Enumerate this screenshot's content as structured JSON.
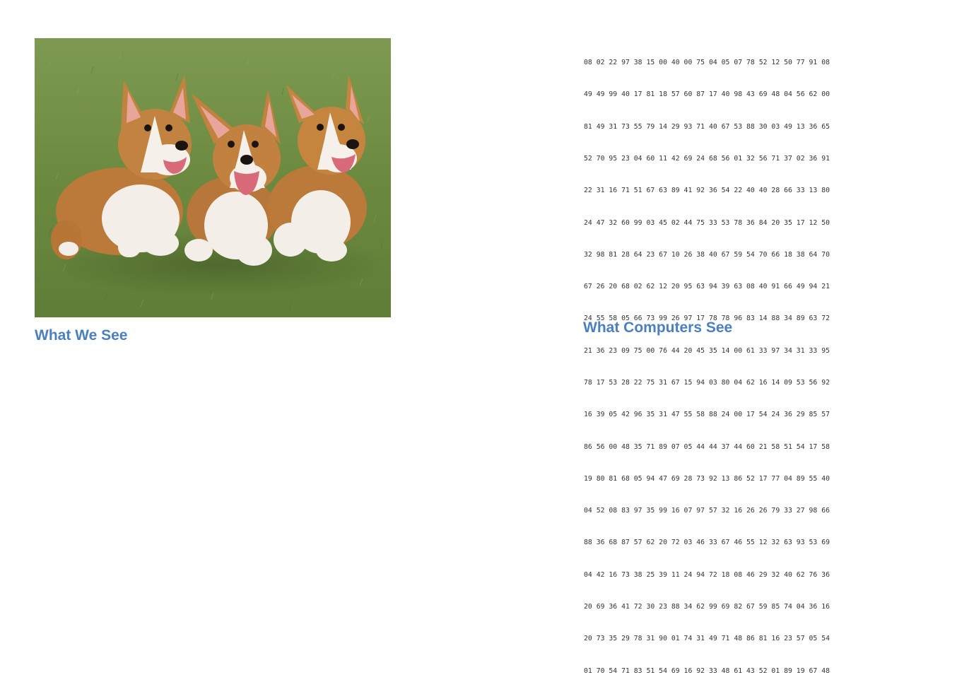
{
  "captions": {
    "left": "What We See",
    "right": "What Computers  See"
  },
  "image": {
    "subject": "three-corgi-puppies-running-on-grass"
  },
  "matrix": [
    "08 02 22 97 38 15 00 40 00 75 04 05 07 78 52 12 50 77 91 08",
    "49 49 99 40 17 81 18 57 60 87 17 40 98 43 69 48 04 56 62 00",
    "81 49 31 73 55 79 14 29 93 71 40 67 53 88 30 03 49 13 36 65",
    "52 70 95 23 04 60 11 42 69 24 68 56 01 32 56 71 37 02 36 91",
    "22 31 16 71 51 67 63 89 41 92 36 54 22 40 40 28 66 33 13 80",
    "24 47 32 60 99 03 45 02 44 75 33 53 78 36 84 20 35 17 12 50",
    "32 98 81 28 64 23 67 10 26 38 40 67 59 54 70 66 18 38 64 70",
    "67 26 20 68 02 62 12 20 95 63 94 39 63 08 40 91 66 49 94 21",
    "24 55 58 05 66 73 99 26 97 17 78 78 96 83 14 88 34 89 63 72",
    "21 36 23 09 75 00 76 44 20 45 35 14 00 61 33 97 34 31 33 95",
    "78 17 53 28 22 75 31 67 15 94 03 80 04 62 16 14 09 53 56 92",
    "16 39 05 42 96 35 31 47 55 58 88 24 00 17 54 24 36 29 85 57",
    "86 56 00 48 35 71 89 07 05 44 44 37 44 60 21 58 51 54 17 58",
    "19 80 81 68 05 94 47 69 28 73 92 13 86 52 17 77 04 89 55 40",
    "04 52 08 83 97 35 99 16 07 97 57 32 16 26 26 79 33 27 98 66",
    "88 36 68 87 57 62 20 72 03 46 33 67 46 55 12 32 63 93 53 69",
    "04 42 16 73 38 25 39 11 24 94 72 18 08 46 29 32 40 62 76 36",
    "20 69 36 41 72 30 23 88 34 62 99 69 82 67 59 85 74 04 36 16",
    "20 73 35 29 78 31 90 01 74 31 49 71 48 86 81 16 23 57 05 54",
    "01 70 54 71 83 51 54 69 16 92 33 48 61 43 52 01 89 19 67 48"
  ],
  "colors": {
    "caption": "#4a7fc1",
    "grass": "#6f8e44",
    "fur_tan": "#c0813d",
    "fur_white": "#f4f1ec"
  }
}
